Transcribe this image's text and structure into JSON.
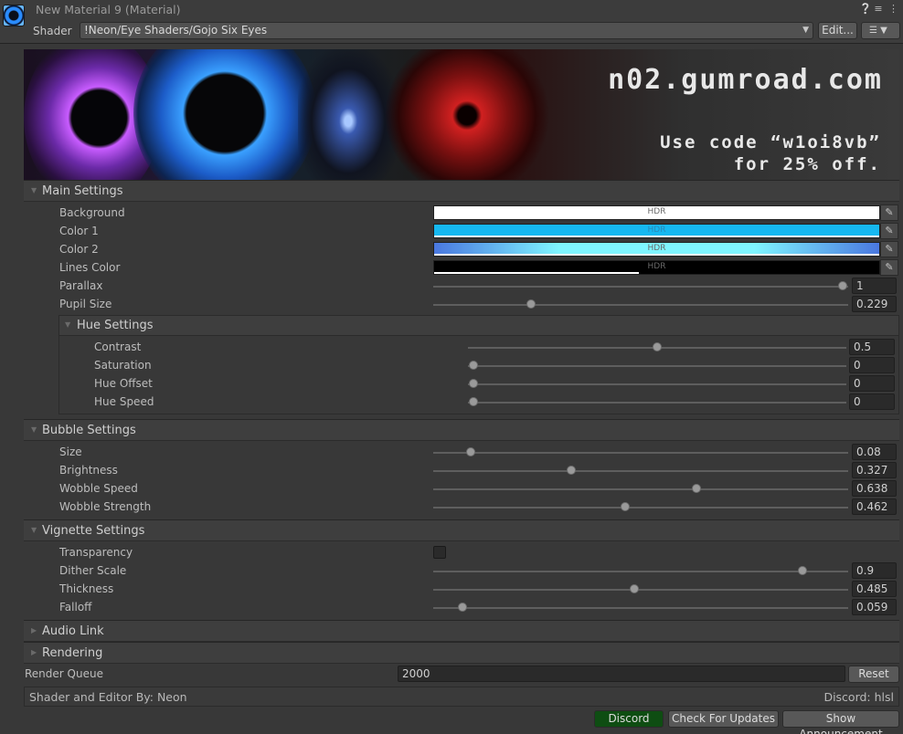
{
  "header": {
    "title": "New Material 9 (Material)",
    "icons": [
      "help-icon",
      "settings-icon",
      "more-icon"
    ],
    "shader_label": "Shader",
    "shader_value": "!Neon/Eye Shaders/Gojo Six Eyes",
    "edit_label": "Edit...",
    "menu_icon": "list-icon"
  },
  "banner": {
    "url": "n02.gumroad.com",
    "code_line1": "Use code “w1oi8vb”",
    "code_line2": "for 25% off."
  },
  "main_settings": {
    "title": "Main Settings",
    "background": {
      "label": "Background",
      "color": "#ffffff",
      "badge": "HDR"
    },
    "color1": {
      "label": "Color 1",
      "color": "#16b8f0",
      "badge": "HDR"
    },
    "color2": {
      "label": "Color 2",
      "gradient": [
        "#4a78e0",
        "#7ff5ff",
        "#7ff5ff",
        "#4a78e0"
      ],
      "badge": "HDR"
    },
    "lines_color": {
      "label": "Lines Color",
      "color": "#000000",
      "badge": "HDR",
      "alpha_fraction": 0.46
    },
    "parallax": {
      "label": "Parallax",
      "value": "1",
      "fraction": 1.0
    },
    "pupil_size": {
      "label": "Pupil Size",
      "value": "0.229",
      "fraction": 0.229
    }
  },
  "hue_settings": {
    "title": "Hue Settings",
    "contrast": {
      "label": "Contrast",
      "value": "0.5",
      "fraction": 0.5
    },
    "saturation": {
      "label": "Saturation",
      "value": "0",
      "fraction": 0
    },
    "hue_offset": {
      "label": "Hue Offset",
      "value": "0",
      "fraction": 0
    },
    "hue_speed": {
      "label": "Hue Speed",
      "value": "0",
      "fraction": 0
    }
  },
  "bubble_settings": {
    "title": "Bubble Settings",
    "size": {
      "label": "Size",
      "value": "0.08",
      "fraction": 0.08
    },
    "brightness": {
      "label": "Brightness",
      "value": "0.327",
      "fraction": 0.327
    },
    "wobble_speed": {
      "label": "Wobble Speed",
      "value": "0.638",
      "fraction": 0.638
    },
    "wobble_strength": {
      "label": "Wobble Strength",
      "value": "0.462",
      "fraction": 0.462
    }
  },
  "vignette_settings": {
    "title": "Vignette Settings",
    "transparency": {
      "label": "Transparency",
      "checked": false
    },
    "dither_scale": {
      "label": "Dither Scale",
      "value": "0.9",
      "fraction": 0.9
    },
    "thickness": {
      "label": "Thickness",
      "value": "0.485",
      "fraction": 0.485
    },
    "falloff": {
      "label": "Falloff",
      "value": "0.059",
      "fraction": 0.059
    }
  },
  "audio_link": {
    "title": "Audio Link"
  },
  "rendering": {
    "title": "Rendering"
  },
  "render_queue": {
    "label": "Render Queue",
    "value": "2000",
    "reset_label": "Reset"
  },
  "credits": {
    "left": "Shader and Editor By: Neon",
    "right": "Discord: hlsl"
  },
  "footer": {
    "discord_label": "Discord",
    "discord_color": "#0e4d12",
    "updates_label": "Check For Updates",
    "announcement_label": "Show Announcement"
  }
}
